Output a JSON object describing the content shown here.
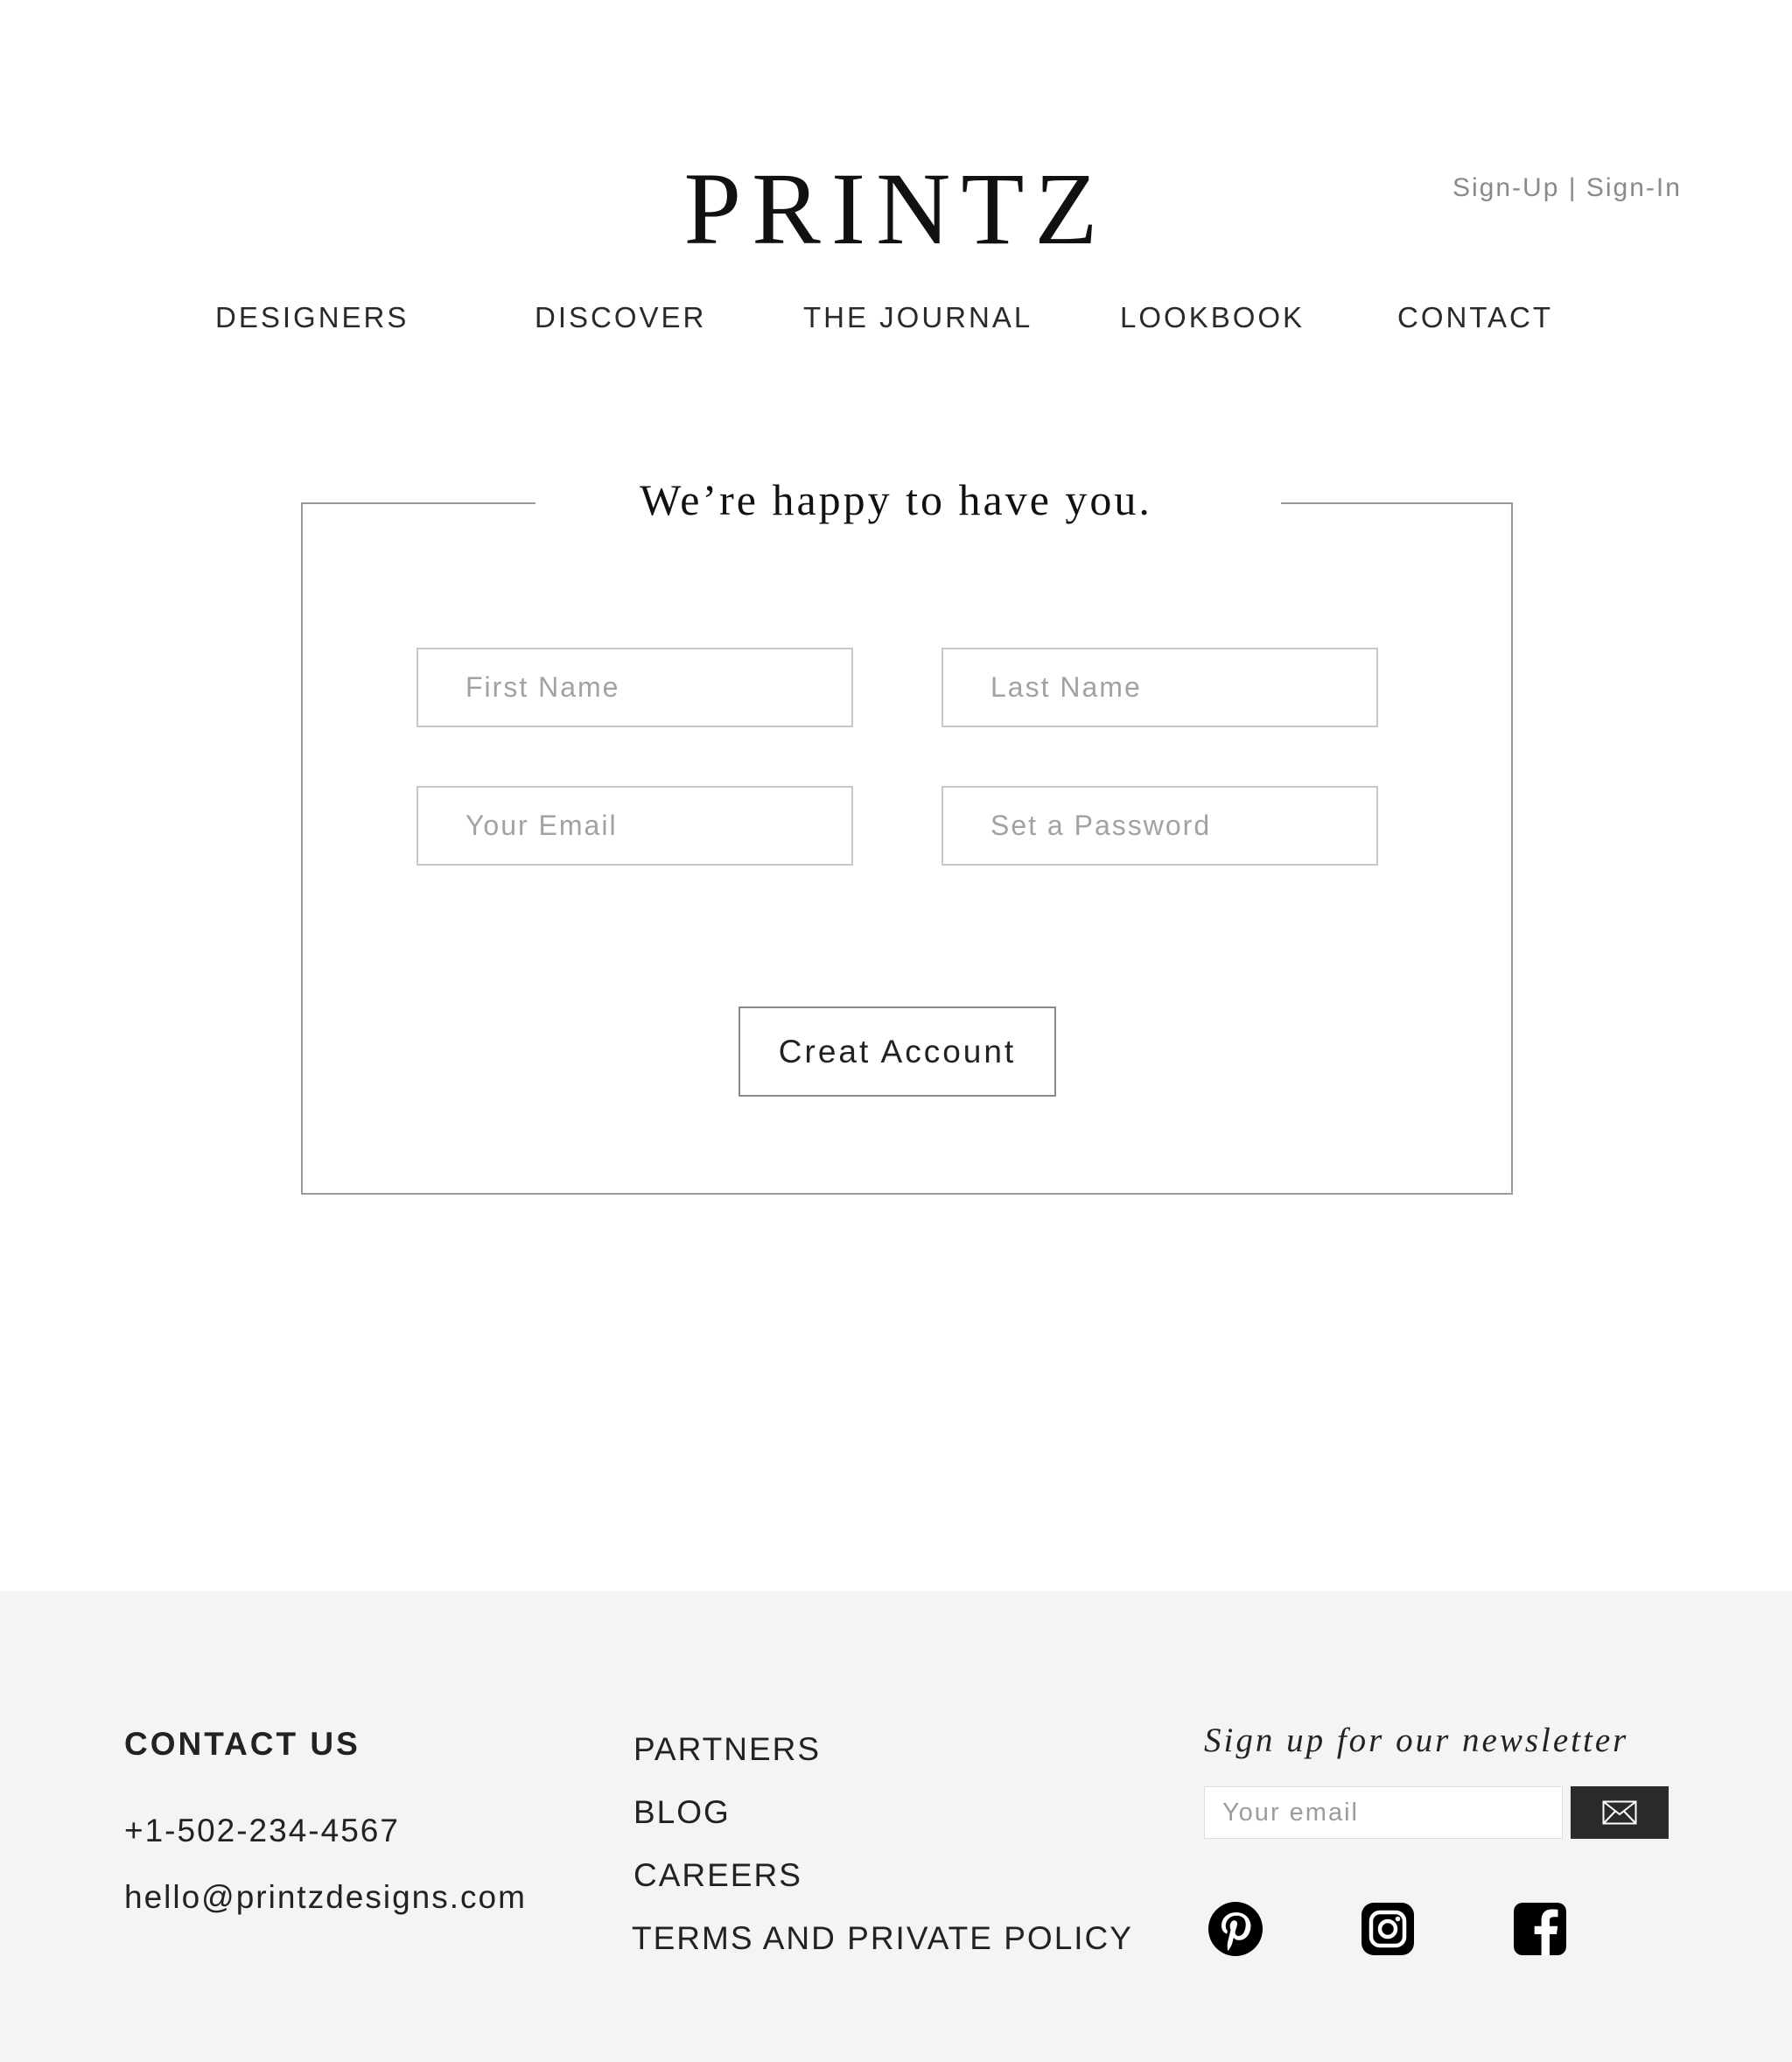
{
  "header": {
    "logo": "PRINTZ",
    "auth_links": "Sign-Up | Sign-In"
  },
  "nav": {
    "items": [
      "DESIGNERS",
      "DISCOVER",
      "THE JOURNAL",
      "LOOKBOOK",
      "CONTACT"
    ]
  },
  "form": {
    "title": "We’re happy to have you.",
    "first_name_placeholder": "First Name",
    "last_name_placeholder": "Last Name",
    "email_placeholder": "Your Email",
    "password_placeholder": "Set a Password",
    "submit_label": "Creat Account"
  },
  "footer": {
    "contact_heading": "CONTACT US",
    "phone": "+1-502-234-4567",
    "email": "hello@printzdesigns.com",
    "links": [
      "PARTNERS",
      "BLOG",
      "CAREERS",
      "TERMS AND PRIVATE POLICY"
    ],
    "newsletter_title": "Sign up for our newsletter",
    "newsletter_placeholder": "Your email",
    "newsletter_submit_icon": "envelope-icon",
    "social_icons": [
      "pinterest-icon",
      "instagram-icon",
      "facebook-icon"
    ]
  },
  "colors": {
    "footer_background": "#f4f4f4",
    "newsletter_button": "#2a2a2a",
    "field_border": "#c8c8c8"
  }
}
